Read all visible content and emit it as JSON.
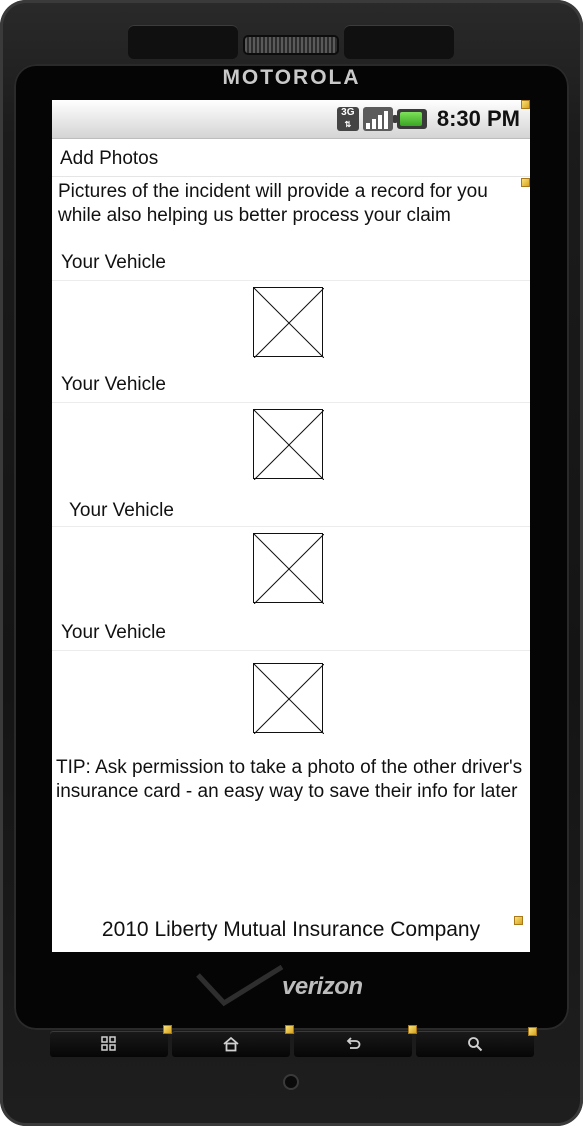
{
  "device": {
    "brand": "MOTOROLA",
    "carrier": "verizon"
  },
  "status_bar": {
    "network": "3G",
    "time": "8:30 PM",
    "battery_color": "#4fc334"
  },
  "screen": {
    "title": "Add Photos",
    "intro": "Pictures of the incident will provide a record for you while also helping us better process your claim",
    "photo_sections": [
      {
        "label": "Your Vehicle",
        "photo": "placeholder"
      },
      {
        "label": "Your Vehicle",
        "photo": "placeholder"
      },
      {
        "label": "Your Vehicle",
        "photo": "placeholder"
      },
      {
        "label": "Your Vehicle",
        "photo": "placeholder"
      }
    ],
    "tip": "TIP: Ask permission to take a photo of the other driver's insurance card - an easy way to save their info for later",
    "footer": "2010 Liberty Mutual Insurance Company"
  },
  "nav_keys": [
    {
      "icon": "menu-icon"
    },
    {
      "icon": "home-icon"
    },
    {
      "icon": "back-icon"
    },
    {
      "icon": "search-icon"
    }
  ]
}
